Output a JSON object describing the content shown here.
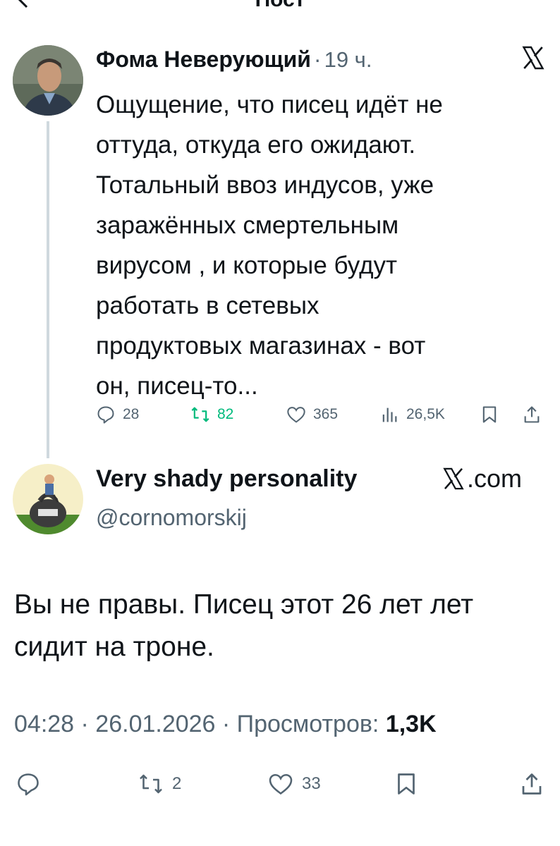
{
  "header": {
    "title": "Пост"
  },
  "quoted": {
    "author_name": "Фома Неверующий",
    "separator": "·",
    "time": "19 ч.",
    "text": "Ощущение, что писец идёт не\nоттуда, откуда его ожидают.\nТотальный ввоз индусов, уже\nзаражённых смертельным\nвирусом , и которые будут\nработать в сетевых\nпродуктовых магазинах - вот\nон, писец-то...",
    "replies": "28",
    "reposts": "82",
    "likes": "365",
    "views": "26,5K"
  },
  "reply": {
    "author_name": "Very shady personality",
    "site_label": ".com",
    "handle": "@cornomorskij",
    "text": "Вы не правы. Писец этот 26 лет лет\nсидит на троне.",
    "meta_time": "04:28 · 26.01.2026 · Просмотров: ",
    "meta_views": "1,3K",
    "reposts": "2",
    "likes": "33"
  },
  "colors": {
    "text": "#0f1419",
    "secondary": "#536471",
    "repost_green": "#00ba7c",
    "line": "#cfd9de"
  }
}
